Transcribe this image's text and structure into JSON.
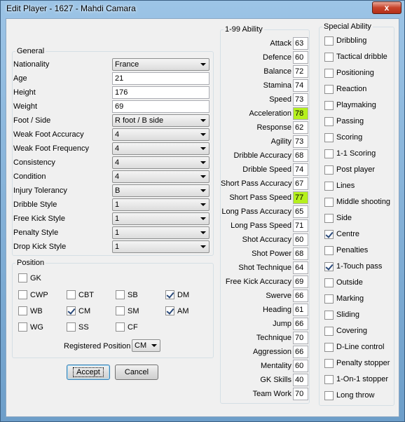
{
  "window": {
    "title": "Edit Player - 1627 - Mahdi Camara",
    "close_glyph": "x"
  },
  "general": {
    "legend": "General",
    "fields": [
      {
        "label": "Nationality",
        "value": "France",
        "kind": "combo"
      },
      {
        "label": "Age",
        "value": "21",
        "kind": "text"
      },
      {
        "label": "Height",
        "value": "176",
        "kind": "text"
      },
      {
        "label": "Weight",
        "value": "69",
        "kind": "text"
      },
      {
        "label": "Foot / Side",
        "value": "R foot / B side",
        "kind": "combo"
      },
      {
        "label": "Weak Foot Accuracy",
        "value": "4",
        "kind": "combo"
      },
      {
        "label": "Weak Foot Frequency",
        "value": "4",
        "kind": "combo"
      },
      {
        "label": "Consistency",
        "value": "4",
        "kind": "combo"
      },
      {
        "label": "Condition",
        "value": "4",
        "kind": "combo"
      },
      {
        "label": "Injury Tolerancy",
        "value": "B",
        "kind": "combo"
      },
      {
        "label": "Dribble Style",
        "value": "1",
        "kind": "combo"
      },
      {
        "label": "Free Kick Style",
        "value": "1",
        "kind": "combo"
      },
      {
        "label": "Penalty Style",
        "value": "1",
        "kind": "combo"
      },
      {
        "label": "Drop Kick Style",
        "value": "1",
        "kind": "combo"
      }
    ]
  },
  "position": {
    "legend": "Position",
    "boxes": [
      {
        "label": "GK",
        "checked": false
      },
      {
        "label": "CWP",
        "checked": false
      },
      {
        "label": "CBT",
        "checked": false
      },
      {
        "label": "SB",
        "checked": false
      },
      {
        "label": "DM",
        "checked": true
      },
      {
        "label": "WB",
        "checked": false
      },
      {
        "label": "CM",
        "checked": true
      },
      {
        "label": "SM",
        "checked": false
      },
      {
        "label": "AM",
        "checked": true
      },
      {
        "label": "WG",
        "checked": false
      },
      {
        "label": "SS",
        "checked": false
      },
      {
        "label": "CF",
        "checked": false
      }
    ],
    "registered_label": "Registered Position",
    "registered_value": "CM"
  },
  "buttons": {
    "accept": "Accept",
    "cancel": "Cancel"
  },
  "ability": {
    "legend": "1-99 Ability",
    "highlight_color": "#b5f01d",
    "items": [
      {
        "label": "Attack",
        "value": "63",
        "highlight": false
      },
      {
        "label": "Defence",
        "value": "60",
        "highlight": false
      },
      {
        "label": "Balance",
        "value": "72",
        "highlight": false
      },
      {
        "label": "Stamina",
        "value": "74",
        "highlight": false
      },
      {
        "label": "Speed",
        "value": "73",
        "highlight": false
      },
      {
        "label": "Acceleration",
        "value": "78",
        "highlight": true
      },
      {
        "label": "Response",
        "value": "62",
        "highlight": false
      },
      {
        "label": "Agility",
        "value": "73",
        "highlight": false
      },
      {
        "label": "Dribble Accuracy",
        "value": "68",
        "highlight": false
      },
      {
        "label": "Dribble Speed",
        "value": "74",
        "highlight": false
      },
      {
        "label": "Short Pass Accuracy",
        "value": "67",
        "highlight": false
      },
      {
        "label": "Short Pass Speed",
        "value": "77",
        "highlight": true
      },
      {
        "label": "Long Pass Accuracy",
        "value": "65",
        "highlight": false
      },
      {
        "label": "Long Pass Speed",
        "value": "71",
        "highlight": false
      },
      {
        "label": "Shot Accuracy",
        "value": "60",
        "highlight": false
      },
      {
        "label": "Shot Power",
        "value": "68",
        "highlight": false
      },
      {
        "label": "Shot Technique",
        "value": "64",
        "highlight": false
      },
      {
        "label": "Free Kick Accuracy",
        "value": "69",
        "highlight": false
      },
      {
        "label": "Swerve",
        "value": "66",
        "highlight": false
      },
      {
        "label": "Heading",
        "value": "61",
        "highlight": false
      },
      {
        "label": "Jump",
        "value": "66",
        "highlight": false
      },
      {
        "label": "Technique",
        "value": "70",
        "highlight": false
      },
      {
        "label": "Aggression",
        "value": "66",
        "highlight": false
      },
      {
        "label": "Mentality",
        "value": "60",
        "highlight": false
      },
      {
        "label": "GK Skills",
        "value": "40",
        "highlight": false
      },
      {
        "label": "Team Work",
        "value": "70",
        "highlight": false
      }
    ]
  },
  "special": {
    "legend": "Special Ability",
    "items": [
      {
        "label": "Dribbling",
        "checked": false
      },
      {
        "label": "Tactical dribble",
        "checked": false
      },
      {
        "label": "Positioning",
        "checked": false
      },
      {
        "label": "Reaction",
        "checked": false
      },
      {
        "label": "Playmaking",
        "checked": false
      },
      {
        "label": "Passing",
        "checked": false
      },
      {
        "label": "Scoring",
        "checked": false
      },
      {
        "label": "1-1 Scoring",
        "checked": false
      },
      {
        "label": "Post player",
        "checked": false
      },
      {
        "label": "Lines",
        "checked": false
      },
      {
        "label": "Middle shooting",
        "checked": false
      },
      {
        "label": "Side",
        "checked": false
      },
      {
        "label": "Centre",
        "checked": true
      },
      {
        "label": "Penalties",
        "checked": false
      },
      {
        "label": "1-Touch pass",
        "checked": true
      },
      {
        "label": "Outside",
        "checked": false
      },
      {
        "label": "Marking",
        "checked": false
      },
      {
        "label": "Sliding",
        "checked": false
      },
      {
        "label": "Covering",
        "checked": false
      },
      {
        "label": "D-Line control",
        "checked": false
      },
      {
        "label": "Penalty stopper",
        "checked": false
      },
      {
        "label": "1-On-1 stopper",
        "checked": false
      },
      {
        "label": "Long throw",
        "checked": false
      }
    ]
  }
}
